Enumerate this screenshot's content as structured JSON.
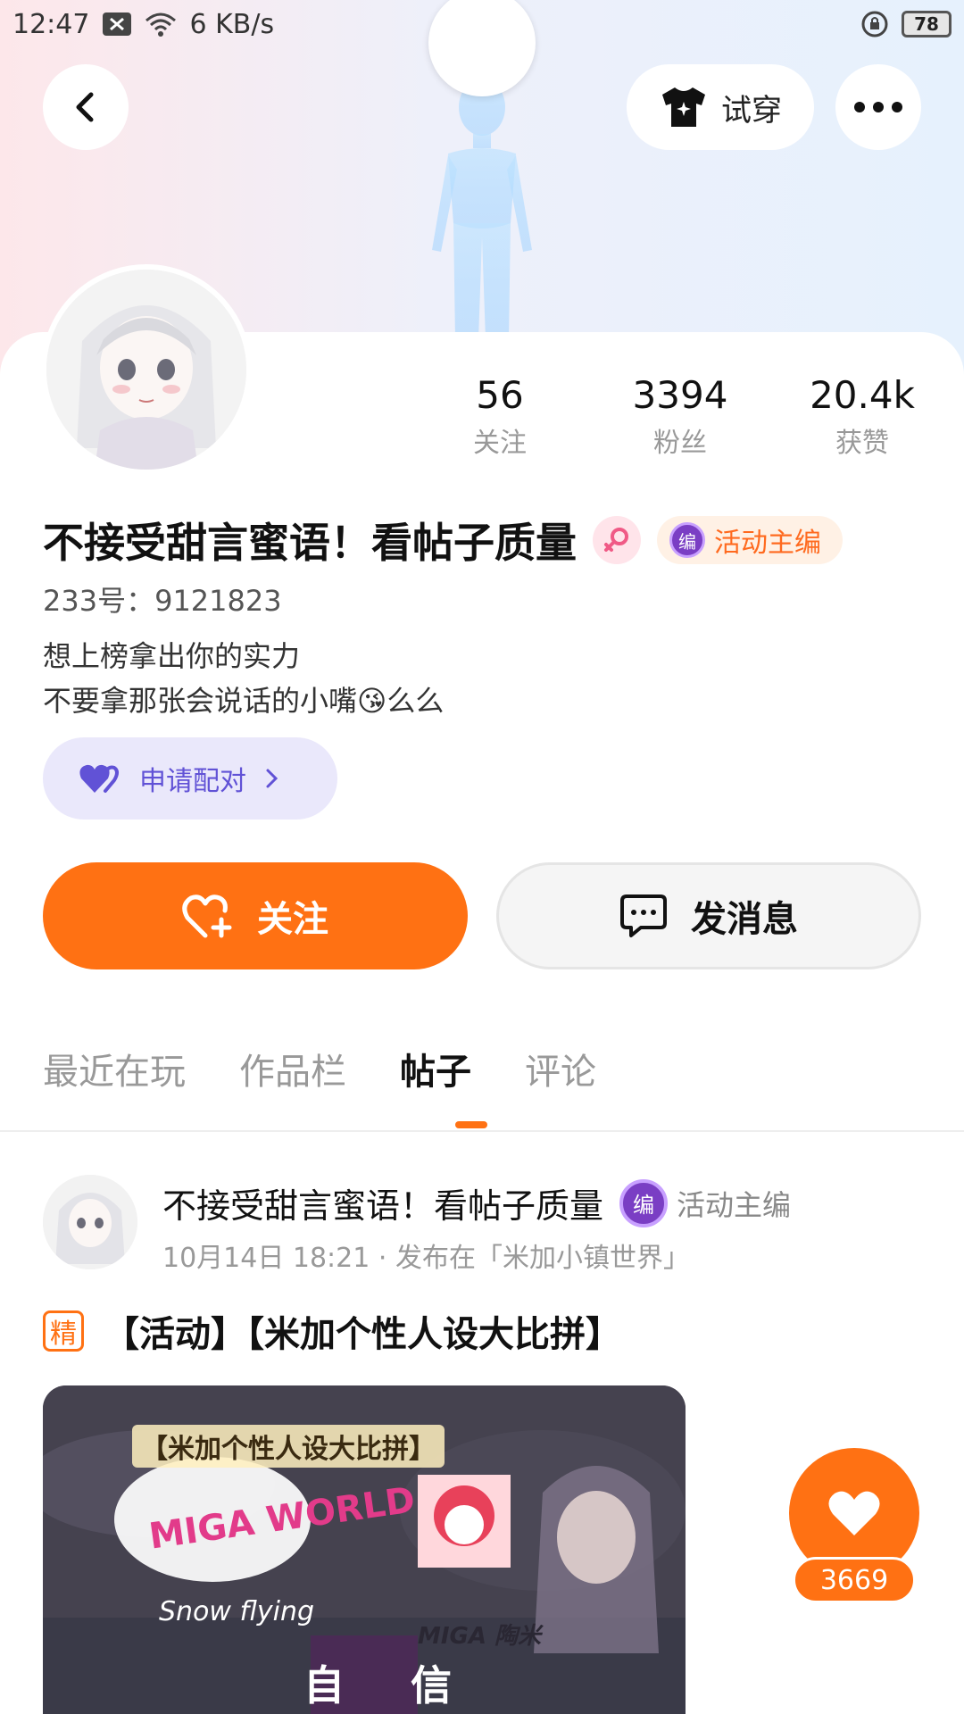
{
  "status_bar": {
    "time": "12:47",
    "net_speed": "6 KB/s",
    "battery": "78"
  },
  "header": {
    "try_on_label": "试穿"
  },
  "stats": [
    {
      "value": "56",
      "label": "关注"
    },
    {
      "value": "3394",
      "label": "粉丝"
    },
    {
      "value": "20.4k",
      "label": "获赞"
    }
  ],
  "profile": {
    "username": "不接受甜言蜜语！看帖子质量",
    "role_badge": "活动主编",
    "role_icon_text": "编",
    "uid": "233号：9121823",
    "bio_line1": "想上榜拿出你的实力",
    "bio_line2": "不要拿那张会说话的小嘴😘么么"
  },
  "actions": {
    "pair_label": "申请配对",
    "follow_label": "关注",
    "message_label": "发消息"
  },
  "tabs": [
    "最近在玩",
    "作品栏",
    "帖子",
    "评论"
  ],
  "post": {
    "author": "不接受甜言蜜语！看帖子质量",
    "role_label": "活动主编",
    "role_icon_text": "编",
    "meta": "10月14日 18:21 · 发布在「米加小镇世界」",
    "featured_tag": "精",
    "title": "【活动】【米加个性人设大比拼】",
    "image_text_top": "【米加个性人设大比拼】",
    "image_logo": "MIGA WORLD",
    "image_signature": "Snow flying",
    "image_watermark": "MIGA 陶米",
    "image_sign_left": "自",
    "image_sign_right": "信",
    "like_count": "3669"
  },
  "colors": {
    "accent": "#ff7113",
    "pair_bg": "#eae8fb",
    "pair_text": "#6152d6",
    "role_badge_bg": "#fff1e5"
  }
}
